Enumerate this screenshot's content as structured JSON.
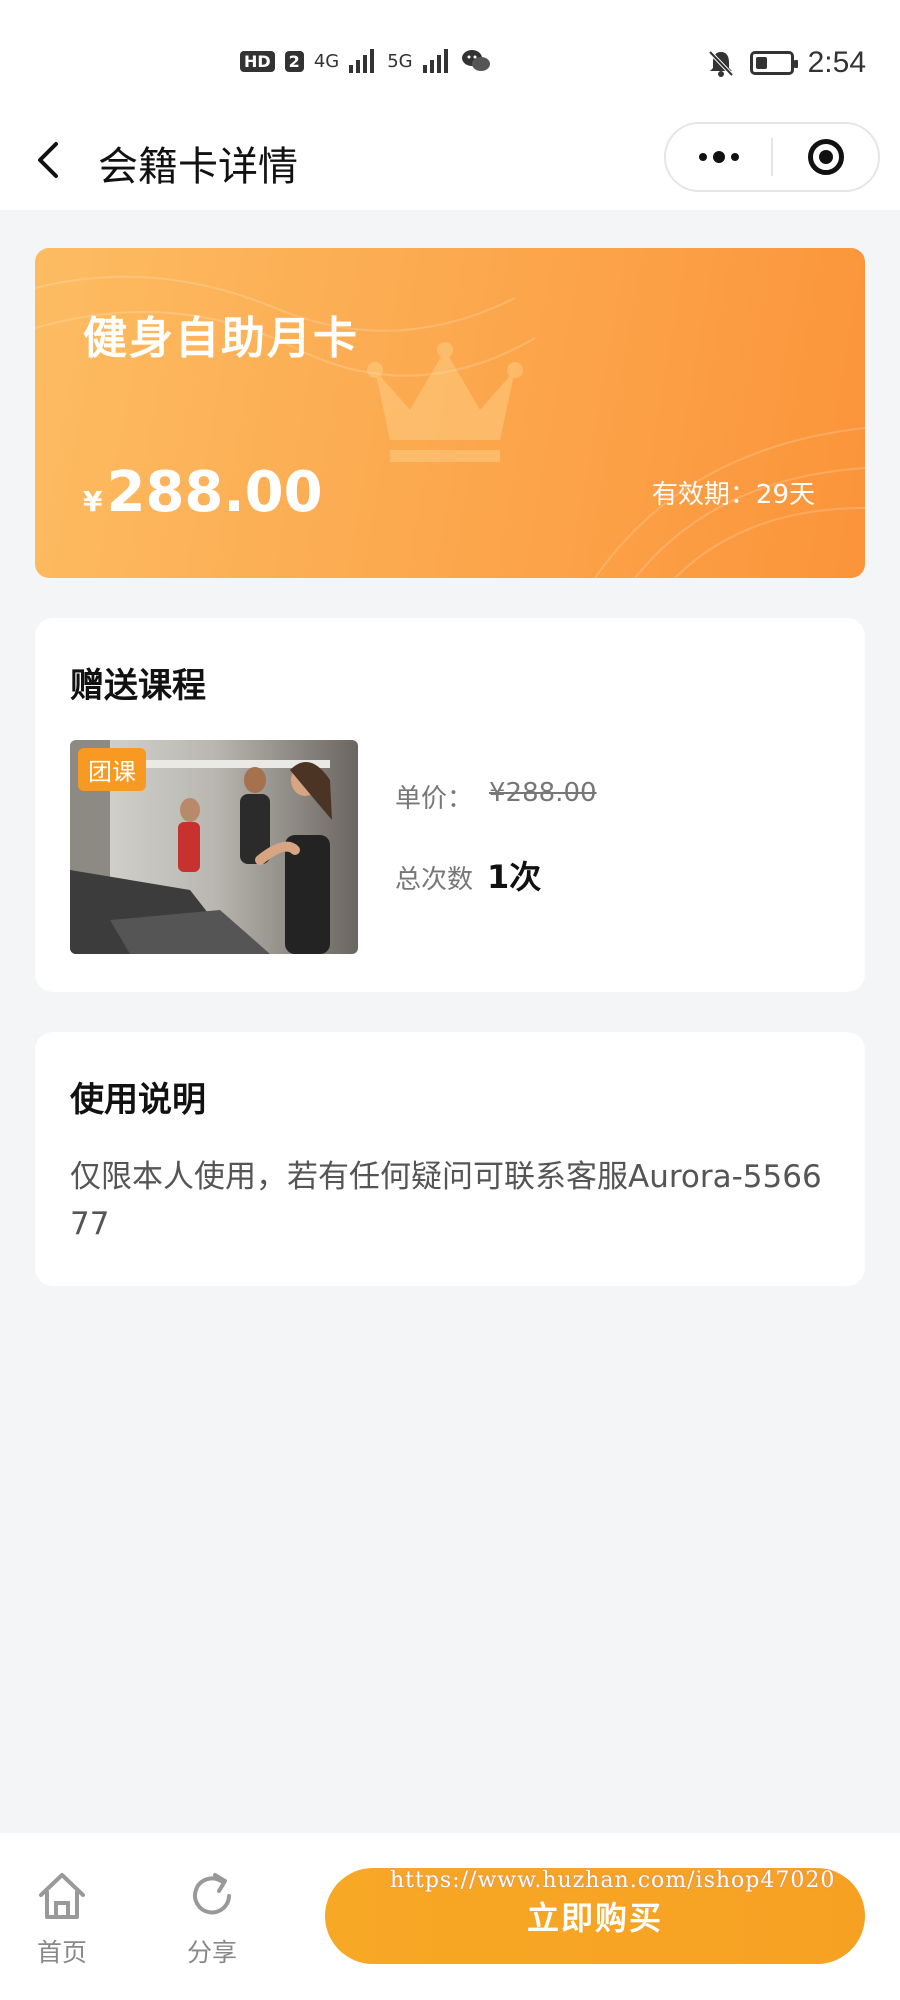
{
  "status_bar": {
    "left_items": [
      "HD",
      "2",
      "4G",
      "5G"
    ],
    "time": "2:54",
    "battery_level": 0.35
  },
  "nav": {
    "title": "会籍卡详情"
  },
  "card": {
    "name": "健身自助月卡",
    "currency": "¥",
    "price": "288.00",
    "validity": "有效期：29天",
    "gradient": [
      "#fdbc62",
      "#fb943a"
    ]
  },
  "gift": {
    "title": "赠送课程",
    "tag": "团课",
    "unit_label": "单价：",
    "unit_price": "¥288.00",
    "count_label": "总次数",
    "count": "1次"
  },
  "usage": {
    "title": "使用说明",
    "text": "仅限本人使用，若有任何疑问可联系客服Aurora-556677"
  },
  "bottom": {
    "home_label": "首页",
    "share_label": "分享",
    "buy_label": "立即购买",
    "accent": "#f7a825"
  },
  "watermark": "https://www.huzhan.com/ishop47020"
}
